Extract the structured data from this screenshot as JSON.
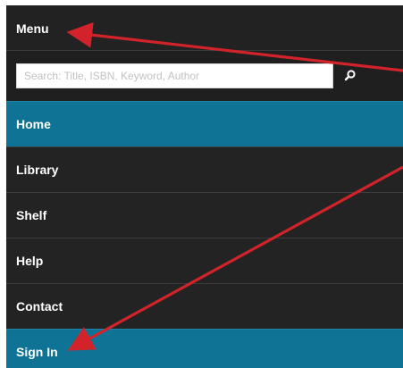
{
  "menu": {
    "title": "Menu"
  },
  "search": {
    "placeholder": "Search: Title, ISBN, Keyword, Author",
    "value": "",
    "icon": "search-icon"
  },
  "nav": {
    "items": [
      {
        "label": "Home",
        "active": true
      },
      {
        "label": "Library",
        "active": false
      },
      {
        "label": "Shelf",
        "active": false
      },
      {
        "label": "Help",
        "active": false
      },
      {
        "label": "Contact",
        "active": false
      },
      {
        "label": "Sign In",
        "active": true
      }
    ]
  },
  "colors": {
    "active": "#0e7394",
    "background": "#1f1f1f",
    "annotation": "#d2232a"
  }
}
